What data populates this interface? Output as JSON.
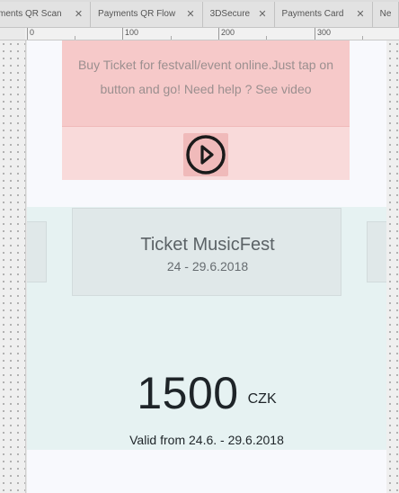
{
  "tabs": [
    {
      "label": "ments QR Scan"
    },
    {
      "label": "Payments QR Flow"
    },
    {
      "label": "3DSecure"
    },
    {
      "label": "Payments Card"
    },
    {
      "label": "Ne"
    }
  ],
  "tab_close_glyph": "✕",
  "ruler": {
    "labels": [
      "0",
      "100",
      "200",
      "300"
    ]
  },
  "info_card": {
    "text": "Buy Ticket for festvall/event online.Just tap on button and go! Need help ? See video",
    "play_icon": "play-circle-icon"
  },
  "ticket": {
    "title": "Ticket MusicFest",
    "dates": "24 - 29.6.2018"
  },
  "price": {
    "amount": "1500",
    "currency": "CZK",
    "validity": "Valid from 24.6. - 29.6.2018"
  },
  "colors": {
    "info_card": "#f6c9c9",
    "ticket_area": "#e6f2f2",
    "price_text": "#1e2428"
  }
}
